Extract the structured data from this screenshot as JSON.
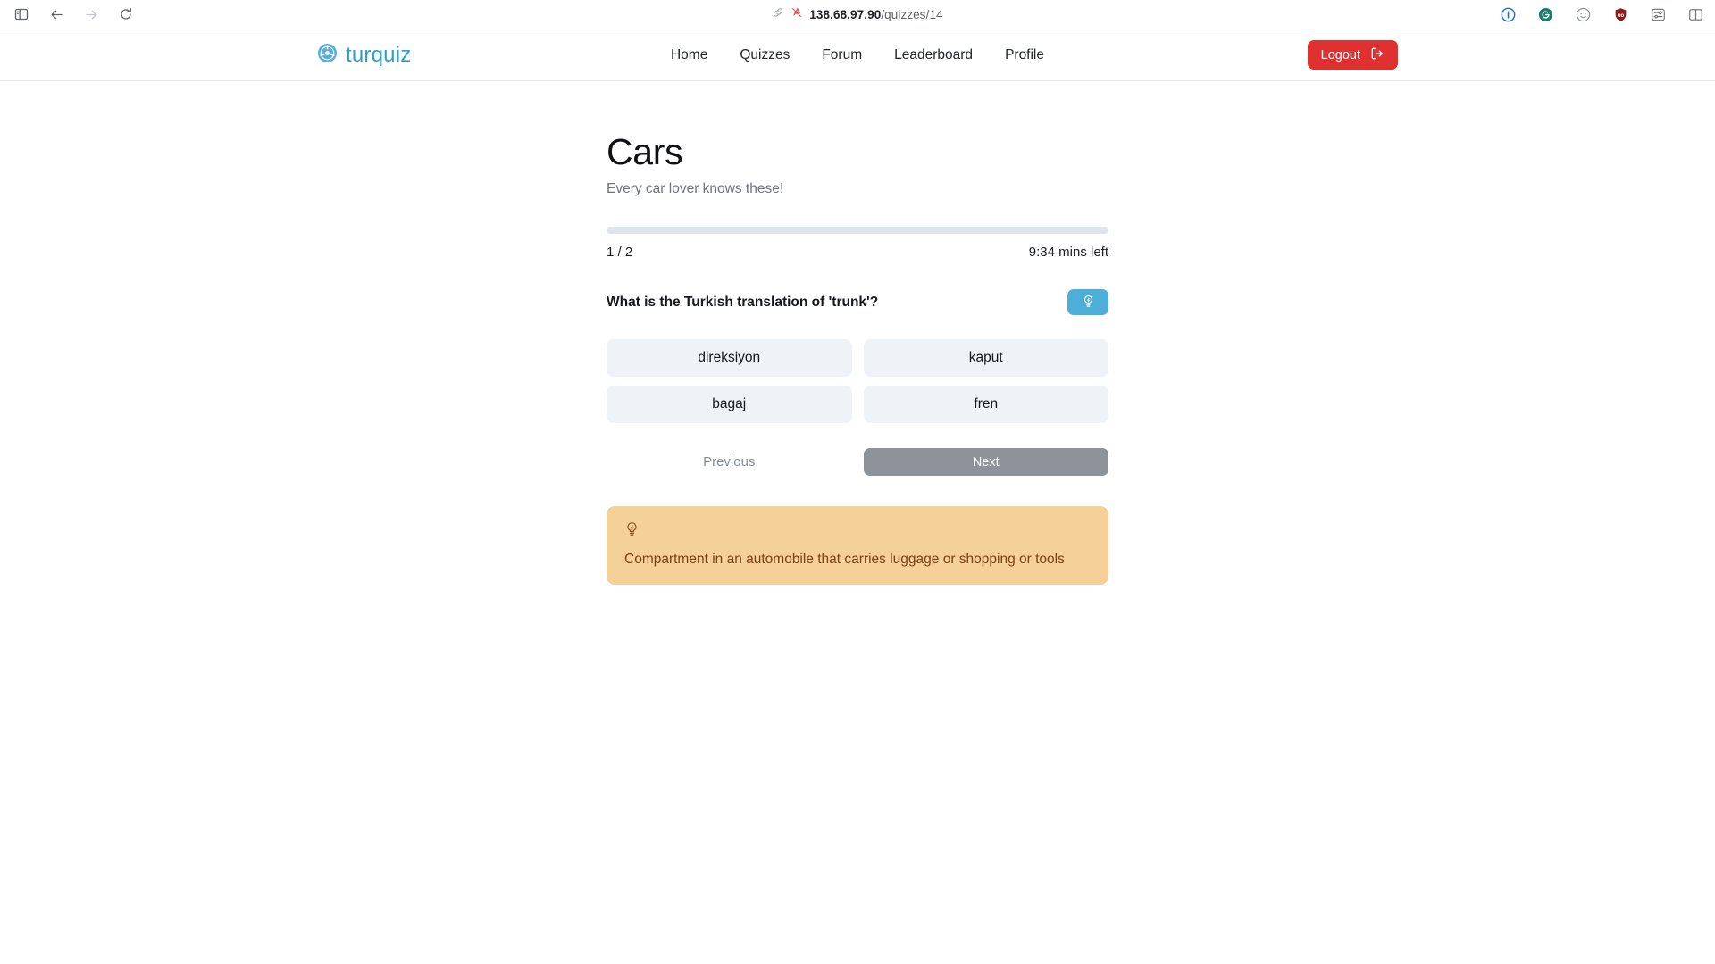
{
  "browser": {
    "url_host": "138.68.97.90",
    "url_path": "/quizzes/14",
    "left_controls": [
      {
        "name": "sidebar-toggle",
        "icon": "sidebar-icon"
      },
      {
        "name": "back",
        "icon": "arrow-left-icon"
      },
      {
        "name": "forward",
        "icon": "arrow-right-icon"
      },
      {
        "name": "reload",
        "icon": "reload-icon"
      }
    ],
    "extensions": [
      {
        "name": "1password",
        "icon": "onepassword-icon"
      },
      {
        "name": "grammarly",
        "icon": "grammarly-icon"
      },
      {
        "name": "face",
        "icon": "face-icon"
      },
      {
        "name": "ublock",
        "icon": "shield-icon"
      },
      {
        "name": "settings",
        "icon": "sliders-icon"
      },
      {
        "name": "split-view",
        "icon": "panels-icon"
      }
    ]
  },
  "header": {
    "brand": "turquiz",
    "brand_icon": "steering-wheel-icon",
    "nav": [
      {
        "label": "Home"
      },
      {
        "label": "Quizzes"
      },
      {
        "label": "Forum"
      },
      {
        "label": "Leaderboard"
      },
      {
        "label": "Profile"
      }
    ],
    "logout_label": "Logout",
    "logout_icon": "logout-icon"
  },
  "quiz": {
    "title": "Cars",
    "description": "Every car lover knows these!",
    "progress_percent": 0,
    "counter": "1 / 2",
    "time_left": "9:34 mins left",
    "question": "What is the Turkish translation of 'trunk'?",
    "hint_button_icon": "lightbulb-icon",
    "options": [
      {
        "label": "direksiyon"
      },
      {
        "label": "kaput"
      },
      {
        "label": "bagaj"
      },
      {
        "label": "fren"
      }
    ],
    "previous_label": "Previous",
    "next_label": "Next",
    "hint": {
      "icon": "lightbulb-icon",
      "text": "Compartment in an automobile that carries luggage or shopping or tools"
    }
  },
  "colors": {
    "brand": "#2b9fd4",
    "logout": "#e03131",
    "hint_button": "#4dafd8",
    "hint_box": "#f5d199",
    "hint_text": "#7a4015",
    "option_bg": "#eff2f7",
    "next_bg": "#8e939b",
    "progress_track": "#dfe3ec"
  }
}
